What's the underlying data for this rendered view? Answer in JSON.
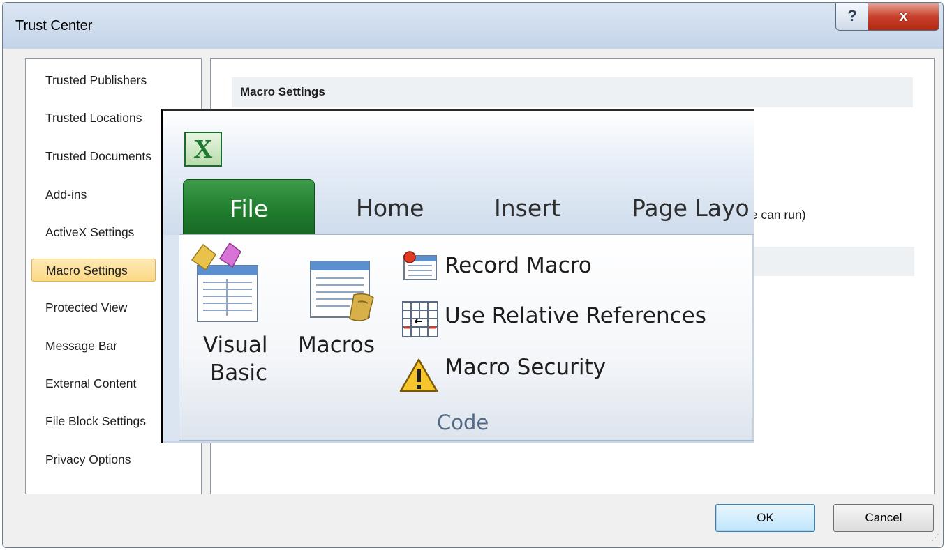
{
  "window": {
    "title": "Trust Center",
    "help_glyph": "?",
    "close_glyph": "x"
  },
  "nav": {
    "items": [
      {
        "label": "Trusted Publishers"
      },
      {
        "label": "Trusted Locations"
      },
      {
        "label": "Trusted Documents"
      },
      {
        "label": "Add-ins"
      },
      {
        "label": "ActiveX Settings"
      },
      {
        "label": "Macro Settings",
        "selected": true
      },
      {
        "label": "Protected View"
      },
      {
        "label": "Message Bar"
      },
      {
        "label": "External Content"
      },
      {
        "label": "File Block Settings"
      },
      {
        "label": "Privacy Options"
      }
    ]
  },
  "main": {
    "section_title": "Macro Settings",
    "partial_option_text": "de can run)"
  },
  "buttons": {
    "ok": "OK",
    "cancel": "Cancel"
  },
  "ribbon": {
    "app_icon_letter": "X",
    "tabs": {
      "file": "File",
      "home": "Home",
      "insert": "Insert",
      "page_layout": "Page Layo"
    },
    "code_group": {
      "visual_basic_line1": "Visual",
      "visual_basic_line2": "Basic",
      "macros": "Macros",
      "record_macro": "Record Macro",
      "use_relative_references": "Use Relative References",
      "macro_security": "Macro Security",
      "group_label": "Code"
    }
  },
  "colors": {
    "file_tab": "#1f7a2c",
    "selected_nav": "#fbd985",
    "close_button": "#c7402b"
  }
}
